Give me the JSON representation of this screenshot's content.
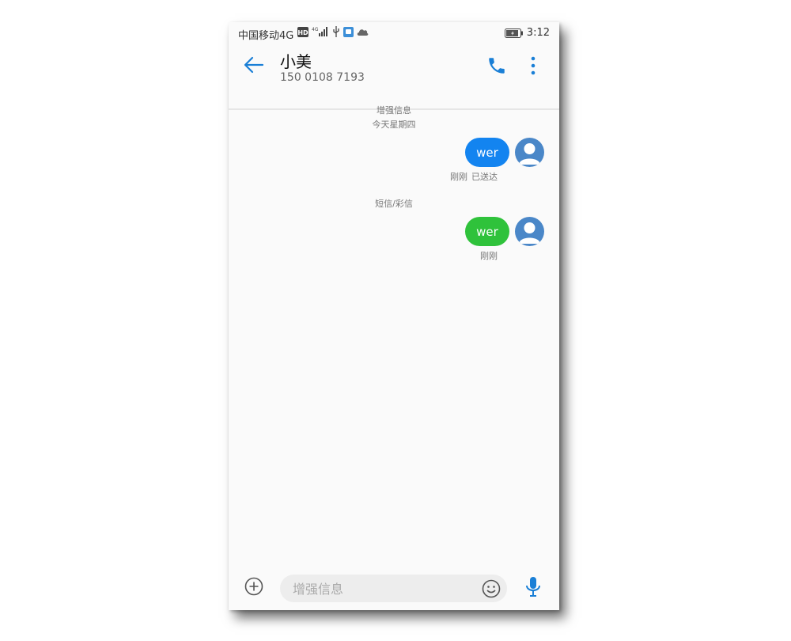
{
  "status_bar": {
    "carrier": "中国移动4G",
    "hd": "HD",
    "net": "4G",
    "time": "3:12"
  },
  "header": {
    "contact_name": "小美",
    "phone_number": "150 0108 7193"
  },
  "thread": {
    "section1_label": "增强信息",
    "date_label": "今天星期四",
    "message1": {
      "text": "wer",
      "time": "刚刚",
      "status": "已送达",
      "color": "#1384f0"
    },
    "section2_label": "短信/彩信",
    "message2": {
      "text": "wer",
      "time": "刚刚",
      "color": "#2fc23b"
    }
  },
  "composer": {
    "placeholder": "增强信息"
  },
  "colors": {
    "accent": "#1a7fd6",
    "avatar": "#4a87c8"
  },
  "icons": [
    "back-arrow-icon",
    "phone-icon",
    "more-vert-icon",
    "add-icon",
    "emoji-icon",
    "mic-icon",
    "avatar-icon"
  ]
}
